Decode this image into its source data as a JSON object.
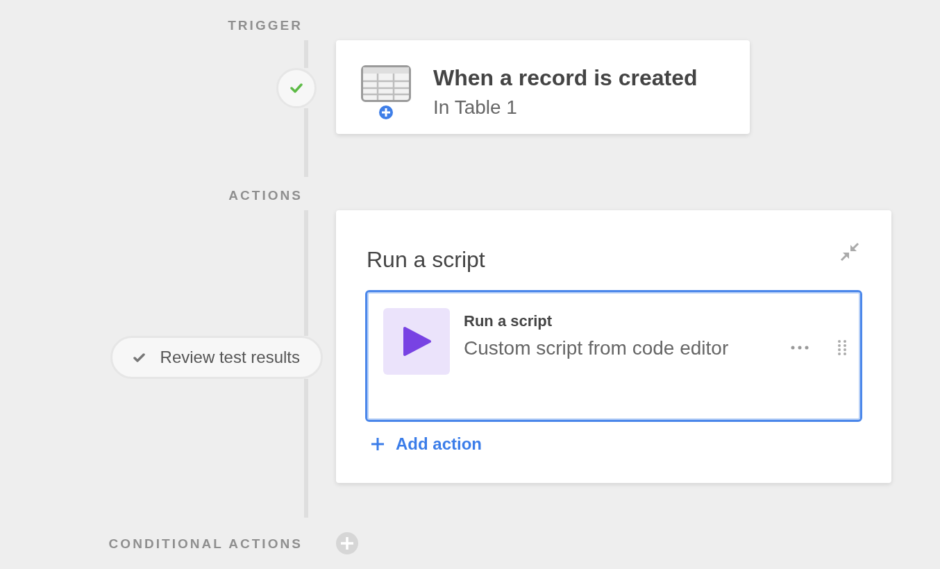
{
  "trigger": {
    "section_label": "TRIGGER",
    "passed": true,
    "title": "When a record is created",
    "subtitle": "In Table 1"
  },
  "actions": {
    "section_label": "ACTIONS",
    "review_button": "Review test results",
    "card": {
      "title": "Run a script",
      "steps": [
        {
          "title": "Run a script",
          "description": "Custom script from code editor",
          "selected": true
        }
      ],
      "add_action": "Add action"
    }
  },
  "conditional_actions": {
    "section_label": "CONDITIONAL ACTIONS"
  }
}
